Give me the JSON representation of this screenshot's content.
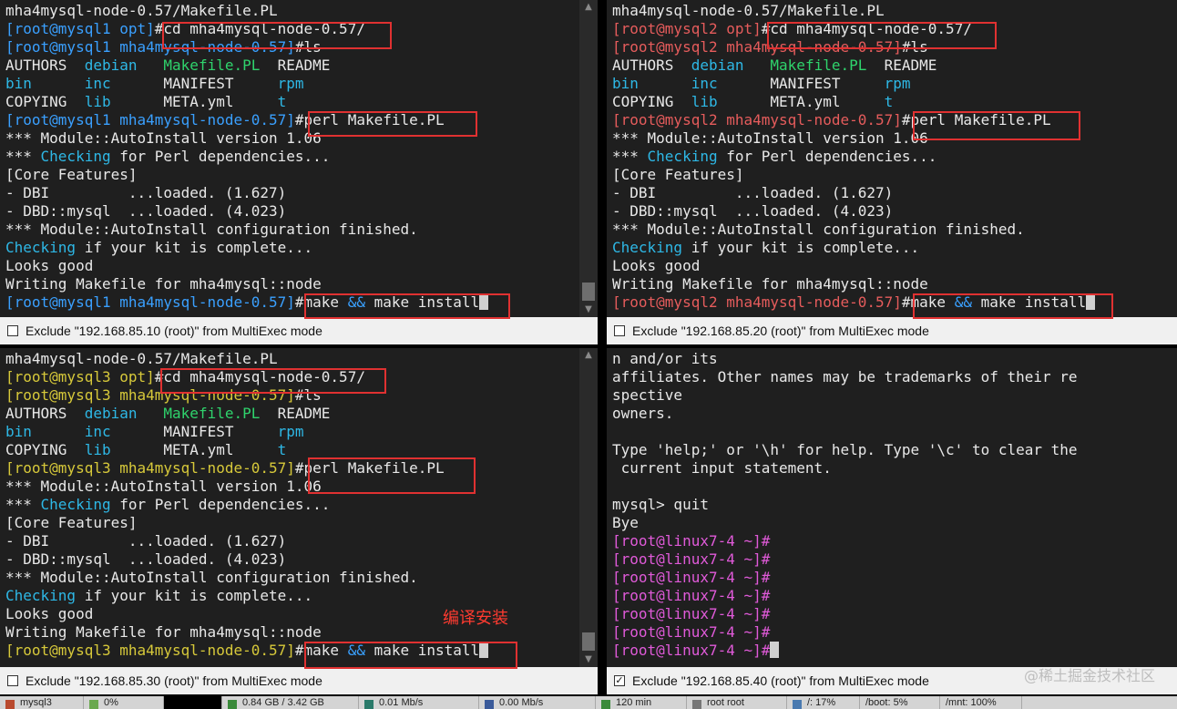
{
  "panes": [
    {
      "exclude_label": "Exclude \"192.168.85.10 (root)\" from MultiExec mode",
      "checked": false,
      "prompt_color": "#3aa0ff",
      "lines": [
        [
          {
            "t": "mha4mysql-node-0.57/Makefile.PL",
            "c": ""
          }
        ],
        [
          {
            "t": "[root@mysql1 opt]",
            "c": "blue"
          },
          {
            "t": "#cd mha4mysql-node-0.57/",
            "c": ""
          }
        ],
        [
          {
            "t": "[root@mysql1 mha4mysql-node-0.57]",
            "c": "blue"
          },
          {
            "t": "#ls",
            "c": ""
          }
        ],
        [
          {
            "t": "AUTHORS  ",
            "c": ""
          },
          {
            "t": "debian",
            "c": "cyan"
          },
          {
            "t": "   ",
            "c": ""
          },
          {
            "t": "Makefile.PL",
            "c": "green"
          },
          {
            "t": "  README",
            "c": ""
          }
        ],
        [
          {
            "t": "bin",
            "c": "cyan"
          },
          {
            "t": "      ",
            "c": ""
          },
          {
            "t": "inc",
            "c": "cyan"
          },
          {
            "t": "      MANIFEST     ",
            "c": ""
          },
          {
            "t": "rpm",
            "c": "cyan"
          }
        ],
        [
          {
            "t": "COPYING  ",
            "c": ""
          },
          {
            "t": "lib",
            "c": "cyan"
          },
          {
            "t": "      META.yml     ",
            "c": ""
          },
          {
            "t": "t",
            "c": "cyan"
          }
        ],
        [
          {
            "t": "[root@mysql1 mha4mysql-node-0.57]",
            "c": "blue"
          },
          {
            "t": "#perl Makefile.PL",
            "c": ""
          }
        ],
        [
          {
            "t": "*** Module::AutoInstall version 1.06",
            "c": ""
          }
        ],
        [
          {
            "t": "*** ",
            "c": ""
          },
          {
            "t": "Checking",
            "c": "cyan"
          },
          {
            "t": " for Perl dependencies...",
            "c": ""
          }
        ],
        [
          {
            "t": "[Core Features]",
            "c": ""
          }
        ],
        [
          {
            "t": "- DBI         ...loaded. (1.627)",
            "c": ""
          }
        ],
        [
          {
            "t": "- DBD::mysql  ...loaded. (4.023)",
            "c": ""
          }
        ],
        [
          {
            "t": "*** Module::AutoInstall configuration finished.",
            "c": ""
          }
        ],
        [
          {
            "t": "Checking",
            "c": "cyan"
          },
          {
            "t": " if your kit is complete...",
            "c": ""
          }
        ],
        [
          {
            "t": "Looks good",
            "c": ""
          }
        ],
        [
          {
            "t": "Writing Makefile for mha4mysql::node",
            "c": ""
          }
        ],
        [
          {
            "t": "[root@mysql1 mha4mysql-node-0.57]",
            "c": "blue"
          },
          {
            "t": "#make ",
            "c": ""
          },
          {
            "t": "&&",
            "c": "amp"
          },
          {
            "t": " make install",
            "c": ""
          },
          {
            "t": "",
            "c": "cursor"
          }
        ]
      ]
    },
    {
      "exclude_label": "Exclude \"192.168.85.20 (root)\" from MultiExec mode",
      "checked": false,
      "lines": [
        [
          {
            "t": "mha4mysql-node-0.57/Makefile.PL",
            "c": ""
          }
        ],
        [
          {
            "t": "[root@mysql2 opt]",
            "c": "red"
          },
          {
            "t": "#cd mha4mysql-node-0.57/",
            "c": ""
          }
        ],
        [
          {
            "t": "[root@mysql2 mha4mysql-node-0.57]",
            "c": "red"
          },
          {
            "t": "#ls",
            "c": ""
          }
        ],
        [
          {
            "t": "AUTHORS  ",
            "c": ""
          },
          {
            "t": "debian",
            "c": "cyan"
          },
          {
            "t": "   ",
            "c": ""
          },
          {
            "t": "Makefile.PL",
            "c": "green"
          },
          {
            "t": "  README",
            "c": ""
          }
        ],
        [
          {
            "t": "bin",
            "c": "cyan"
          },
          {
            "t": "      ",
            "c": ""
          },
          {
            "t": "inc",
            "c": "cyan"
          },
          {
            "t": "      MANIFEST     ",
            "c": ""
          },
          {
            "t": "rpm",
            "c": "cyan"
          }
        ],
        [
          {
            "t": "COPYING  ",
            "c": ""
          },
          {
            "t": "lib",
            "c": "cyan"
          },
          {
            "t": "      META.yml     ",
            "c": ""
          },
          {
            "t": "t",
            "c": "cyan"
          }
        ],
        [
          {
            "t": "[root@mysql2 mha4mysql-node-0.57]",
            "c": "red"
          },
          {
            "t": "#perl Makefile.PL",
            "c": ""
          }
        ],
        [
          {
            "t": "*** Module::AutoInstall version 1.06",
            "c": ""
          }
        ],
        [
          {
            "t": "*** ",
            "c": ""
          },
          {
            "t": "Checking",
            "c": "cyan"
          },
          {
            "t": " for Perl dependencies...",
            "c": ""
          }
        ],
        [
          {
            "t": "[Core Features]",
            "c": ""
          }
        ],
        [
          {
            "t": "- DBI         ...loaded. (1.627)",
            "c": ""
          }
        ],
        [
          {
            "t": "- DBD::mysql  ...loaded. (4.023)",
            "c": ""
          }
        ],
        [
          {
            "t": "*** Module::AutoInstall configuration finished.",
            "c": ""
          }
        ],
        [
          {
            "t": "Checking",
            "c": "cyan"
          },
          {
            "t": " if your kit is complete...",
            "c": ""
          }
        ],
        [
          {
            "t": "Looks good",
            "c": ""
          }
        ],
        [
          {
            "t": "Writing Makefile for mha4mysql::node",
            "c": ""
          }
        ],
        [
          {
            "t": "[root@mysql2 mha4mysql-node-0.57]",
            "c": "red"
          },
          {
            "t": "#make ",
            "c": ""
          },
          {
            "t": "&&",
            "c": "amp"
          },
          {
            "t": " make install",
            "c": ""
          },
          {
            "t": "",
            "c": "cursor"
          }
        ]
      ]
    },
    {
      "exclude_label": "Exclude \"192.168.85.30 (root)\" from MultiExec mode",
      "checked": false,
      "lines": [
        [
          {
            "t": "mha4mysql-node-0.57/Makefile.PL",
            "c": ""
          }
        ],
        [
          {
            "t": "[root@mysql3 opt]",
            "c": "yel"
          },
          {
            "t": "#cd mha4mysql-node-0.57/",
            "c": ""
          }
        ],
        [
          {
            "t": "[root@mysql3 mha4mysql-node-0.57]",
            "c": "yel"
          },
          {
            "t": "#ls",
            "c": ""
          }
        ],
        [
          {
            "t": "AUTHORS  ",
            "c": ""
          },
          {
            "t": "debian",
            "c": "cyan"
          },
          {
            "t": "   ",
            "c": ""
          },
          {
            "t": "Makefile.PL",
            "c": "green"
          },
          {
            "t": "  README",
            "c": ""
          }
        ],
        [
          {
            "t": "bin",
            "c": "cyan"
          },
          {
            "t": "      ",
            "c": ""
          },
          {
            "t": "inc",
            "c": "cyan"
          },
          {
            "t": "      MANIFEST     ",
            "c": ""
          },
          {
            "t": "rpm",
            "c": "cyan"
          }
        ],
        [
          {
            "t": "COPYING  ",
            "c": ""
          },
          {
            "t": "lib",
            "c": "cyan"
          },
          {
            "t": "      META.yml     ",
            "c": ""
          },
          {
            "t": "t",
            "c": "cyan"
          }
        ],
        [
          {
            "t": "[root@mysql3 mha4mysql-node-0.57]",
            "c": "yel"
          },
          {
            "t": "#perl Makefile.PL",
            "c": ""
          }
        ],
        [
          {
            "t": "*** Module::AutoInstall version 1.06",
            "c": ""
          }
        ],
        [
          {
            "t": "*** ",
            "c": ""
          },
          {
            "t": "Checking",
            "c": "cyan"
          },
          {
            "t": " for Perl dependencies...",
            "c": ""
          }
        ],
        [
          {
            "t": "[Core Features]",
            "c": ""
          }
        ],
        [
          {
            "t": "- DBI         ...loaded. (1.627)",
            "c": ""
          }
        ],
        [
          {
            "t": "- DBD::mysql  ...loaded. (4.023)",
            "c": ""
          }
        ],
        [
          {
            "t": "*** Module::AutoInstall configuration finished.",
            "c": ""
          }
        ],
        [
          {
            "t": "Checking",
            "c": "cyan"
          },
          {
            "t": " if your kit is complete...",
            "c": ""
          }
        ],
        [
          {
            "t": "Looks good",
            "c": ""
          }
        ],
        [
          {
            "t": "Writing Makefile for mha4mysql::node",
            "c": ""
          }
        ],
        [
          {
            "t": "[root@mysql3 mha4mysql-node-0.57]",
            "c": "yel"
          },
          {
            "t": "#make ",
            "c": ""
          },
          {
            "t": "&&",
            "c": "amp"
          },
          {
            "t": " make install",
            "c": ""
          },
          {
            "t": "",
            "c": "cursor"
          }
        ]
      ]
    },
    {
      "exclude_label": "Exclude \"192.168.85.40 (root)\" from MultiExec mode",
      "checked": true,
      "lines": [
        [
          {
            "t": "n and/or its",
            "c": ""
          }
        ],
        [
          {
            "t": "affiliates. Other names may be trademarks of their re",
            "c": ""
          }
        ],
        [
          {
            "t": "spective",
            "c": ""
          }
        ],
        [
          {
            "t": "owners.",
            "c": ""
          }
        ],
        [
          {
            "t": "",
            "c": ""
          }
        ],
        [
          {
            "t": "Type 'help;' or '\\h' for help. Type '\\c' to clear the",
            "c": ""
          }
        ],
        [
          {
            "t": " current input statement.",
            "c": ""
          }
        ],
        [
          {
            "t": "",
            "c": ""
          }
        ],
        [
          {
            "t": "mysql> quit",
            "c": ""
          }
        ],
        [
          {
            "t": "Bye",
            "c": ""
          }
        ],
        [
          {
            "t": "[root@linux7-4 ~]#",
            "c": "mag"
          }
        ],
        [
          {
            "t": "[root@linux7-4 ~]#",
            "c": "mag"
          }
        ],
        [
          {
            "t": "[root@linux7-4 ~]#",
            "c": "mag"
          }
        ],
        [
          {
            "t": "[root@linux7-4 ~]#",
            "c": "mag"
          }
        ],
        [
          {
            "t": "[root@linux7-4 ~]#",
            "c": "mag"
          }
        ],
        [
          {
            "t": "[root@linux7-4 ~]#",
            "c": "mag"
          }
        ],
        [
          {
            "t": "[root@linux7-4 ~]#",
            "c": "mag"
          },
          {
            "t": "",
            "c": "cursor"
          }
        ]
      ]
    }
  ],
  "annotation": "编译安装",
  "watermark": "@稀土掘金技术社区",
  "taskbar": [
    {
      "label": "mysql3",
      "icon": "terminal-icon",
      "color": "#b94a2e"
    },
    {
      "label": "0%",
      "icon": "cpu-icon",
      "color": "#6aa84f"
    },
    {
      "label": "",
      "icon": "",
      "color": "#000000"
    },
    {
      "label": "0.84 GB / 3.42 GB",
      "icon": "memory-icon",
      "color": "#3a8a3a"
    },
    {
      "label": "0.01 Mb/s",
      "icon": "upload-icon",
      "color": "#2a7a6a"
    },
    {
      "label": "0.00 Mb/s",
      "icon": "download-icon",
      "color": "#3a5a9a"
    },
    {
      "label": "120 min",
      "icon": "clock-icon",
      "color": "#3a8a3a"
    },
    {
      "label": "root  root",
      "icon": "user-icon",
      "color": "#777777"
    },
    {
      "label": "/: 17%",
      "icon": "disk-icon",
      "color": "#4a7ab0"
    },
    {
      "label": "/boot: 5%",
      "icon": "",
      "color": ""
    },
    {
      "label": "/mnt: 100%",
      "icon": "",
      "color": ""
    }
  ]
}
